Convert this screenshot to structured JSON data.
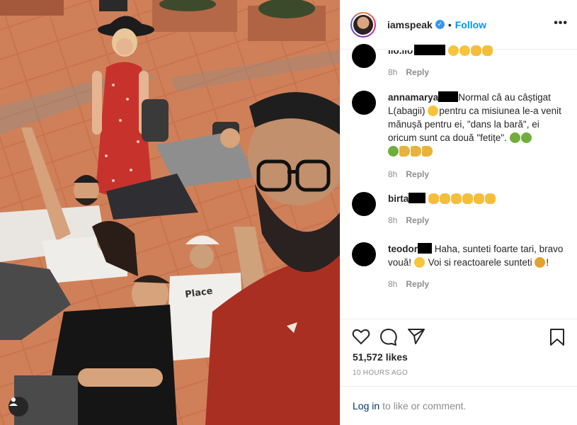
{
  "post": {
    "username": "iamspeak",
    "follow_label": "Follow",
    "separator": "•",
    "more_label": "•••"
  },
  "comments": [
    {
      "user": "ilo.ilo",
      "text_before": "",
      "text": "",
      "emojis": [
        "smile",
        "smile",
        "clap",
        "clap"
      ],
      "time": "8h",
      "reply": "Reply"
    },
    {
      "user": "annamarya",
      "text": "Normal că au câștigat L(abagii)",
      "text2": "pentru ca misiunea le-a venit mănușă pentru ei, \"dans la bară\", ei oricum sunt ca două \"fetițe\".",
      "time": "8h",
      "reply": "Reply"
    },
    {
      "user": "birta",
      "text": "",
      "time": "8h",
      "reply": "Reply"
    },
    {
      "user": "teodor",
      "text": "Haha, sunteti foarte tari, bravo vouă!",
      "text2": "Voi si reactoarele sunteti",
      "text3": "!",
      "time": "8h",
      "reply": "Reply"
    }
  ],
  "stats": {
    "likes": "51,572 likes",
    "time_ago": "10 HOURS AGO"
  },
  "login": {
    "link": "Log in",
    "rest": "to like or comment."
  },
  "icons": [
    "heart-icon",
    "comment-icon",
    "share-icon",
    "bookmark-icon",
    "verified-icon",
    "user-tag-icon",
    "more-icon"
  ]
}
